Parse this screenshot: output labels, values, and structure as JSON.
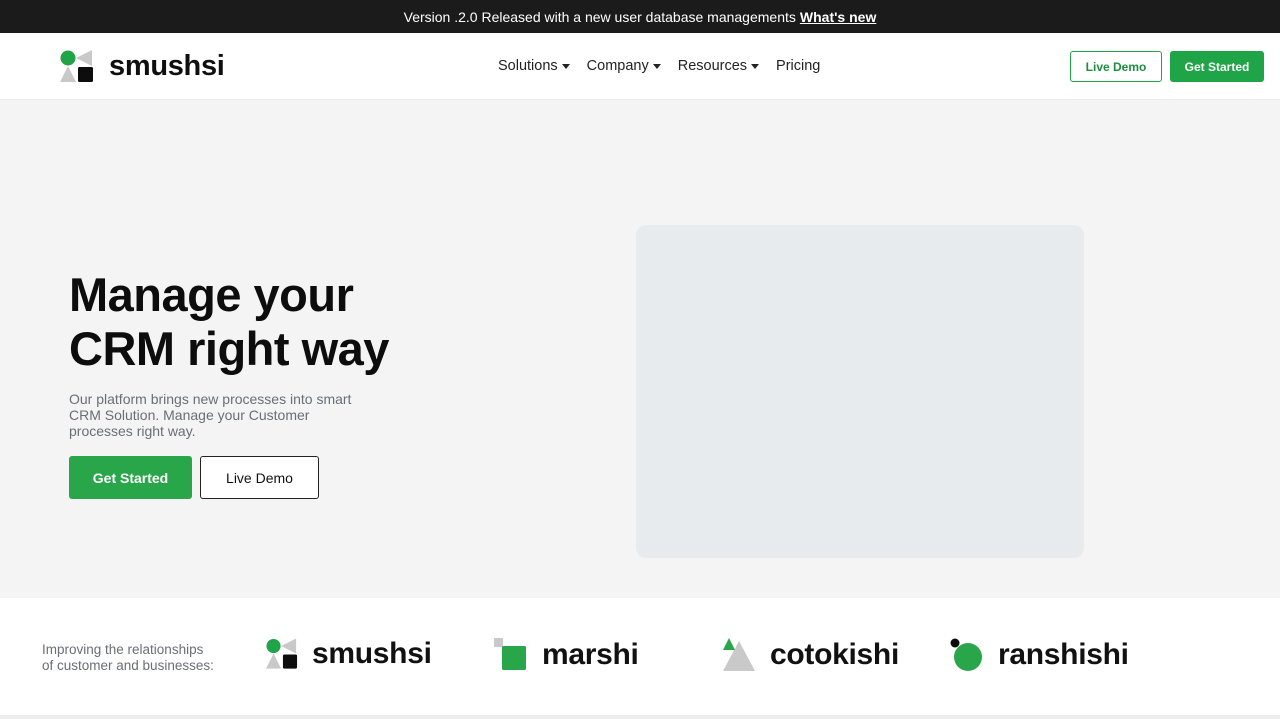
{
  "announcement": {
    "text": "Version .2.0 Released with a new user database managements",
    "link": "What's new"
  },
  "nav": {
    "brand": "smushsi",
    "links": [
      {
        "label": "Solutions",
        "has_dropdown": true
      },
      {
        "label": "Company",
        "has_dropdown": true
      },
      {
        "label": "Resources",
        "has_dropdown": true
      },
      {
        "label": "Pricing",
        "has_dropdown": false
      }
    ],
    "live_demo": "Live Demo",
    "get_started": "Get Started"
  },
  "hero": {
    "title_line1": "Manage your",
    "title_line2": "CRM right way",
    "subtitle_line1": "Our platform brings new processes into smart",
    "subtitle_line2": "CRM Solution. Manage your Customer",
    "subtitle_line3": "processes right way.",
    "primary_button": "Get Started",
    "secondary_button": "Live Demo"
  },
  "clients": {
    "text_line1": "Improving the relationships",
    "text_line2": "of customer and businesses:",
    "logos": [
      "smushsi",
      "marshi",
      "cotokishi",
      "ranshishi"
    ]
  },
  "colors": {
    "accent_green": "#1fa548",
    "topbar": "#1b1b1b",
    "hero_bg": "#f4f4f4",
    "media_placeholder": "#e8ebee"
  }
}
